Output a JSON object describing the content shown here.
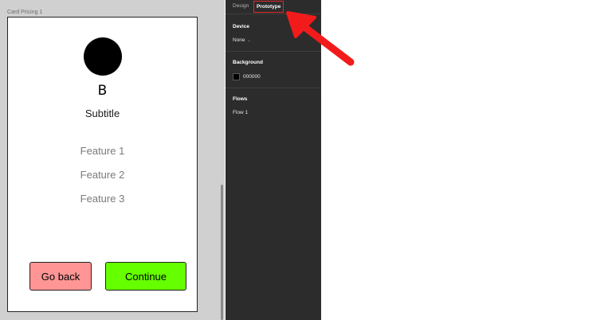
{
  "canvas": {
    "frame_label": "Card Pricing 1",
    "card": {
      "title": "B",
      "subtitle": "Subtitle",
      "features": [
        "Feature 1",
        "Feature 2",
        "Feature 3"
      ],
      "buttons": {
        "back_label": "Go back",
        "continue_label": "Continue"
      }
    }
  },
  "panel": {
    "tabs": [
      {
        "label": "Design",
        "active": false
      },
      {
        "label": "Prototype",
        "active": true
      }
    ],
    "device": {
      "title": "Device",
      "value": "None",
      "chevron": "⌄"
    },
    "background": {
      "title": "Background",
      "value": "000000",
      "swatch_color": "#000000"
    },
    "flows": {
      "title": "Flows",
      "items": [
        "Flow 1"
      ]
    }
  },
  "colors": {
    "back_button": "#ff9595",
    "continue_button": "#66ff00",
    "panel_bg": "#2c2c2c",
    "canvas_bg": "#d0d0d0",
    "highlight": "#e0262a"
  },
  "icons": {
    "annotation": "red-arrow-icon",
    "avatar": "avatar-circle"
  }
}
